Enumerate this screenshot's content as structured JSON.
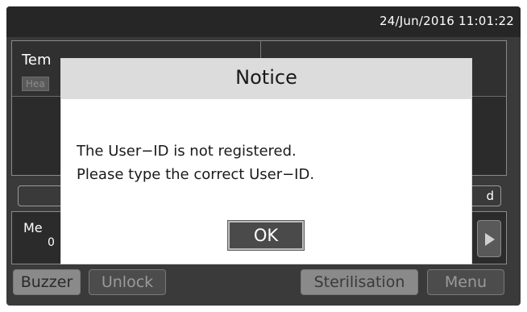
{
  "status_bar": {
    "datetime": "24/Jun/2016 11:01:22"
  },
  "background": {
    "temp_label": "Tem",
    "heat_badge": "Hea",
    "bar_row_text": "d",
    "me_label": "Me",
    "me_value": "0"
  },
  "dialog": {
    "title": "Notice",
    "message_line1": "The User−ID is not registered.",
    "message_line2": "Please type the correct User−ID.",
    "ok_label": "OK"
  },
  "bottom_buttons": {
    "buzzer": "Buzzer",
    "unlock": "Unlock",
    "sterilisation": "Sterilisation",
    "menu": "Menu"
  },
  "icons": {
    "arrow": "play-right-icon"
  }
}
